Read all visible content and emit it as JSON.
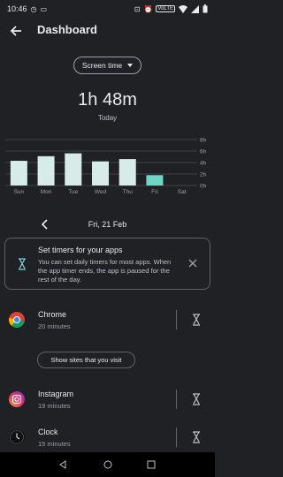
{
  "status_bar": {
    "time": "10:46",
    "volte": "VoLTE"
  },
  "header": {
    "title": "Dashboard"
  },
  "dropdown": {
    "label": "Screen time"
  },
  "summary": {
    "total": "1h 48m",
    "period": "Today"
  },
  "chart_data": {
    "type": "bar",
    "categories": [
      "Sun",
      "Mon",
      "Tue",
      "Wed",
      "Thu",
      "Fri",
      "Sat"
    ],
    "values": [
      4.3,
      5.1,
      5.6,
      4.2,
      4.6,
      1.8,
      0
    ],
    "highlight_index": 5,
    "ylim": [
      0,
      8
    ],
    "ytick_labels": [
      "8h",
      "6h",
      "4h",
      "2h",
      "0h"
    ],
    "colors": {
      "bar": "#d7ece8",
      "highlight": "#6fd6c6",
      "grid": "#5f6368",
      "text": "#9aa0a6"
    }
  },
  "date_nav": {
    "label": "Fri, 21 Feb"
  },
  "timer_card": {
    "title": "Set timers for your apps",
    "body": "You can set daily timers for most apps. When the app timer ends, the app is paused for the rest of the day."
  },
  "apps": [
    {
      "name": "Chrome",
      "time": "20 minutes"
    },
    {
      "name": "Instagram",
      "time": "19 minutes"
    },
    {
      "name": "Clock",
      "time": "15 minutes"
    }
  ],
  "sites_button": {
    "label": "Show sites that you visit"
  }
}
